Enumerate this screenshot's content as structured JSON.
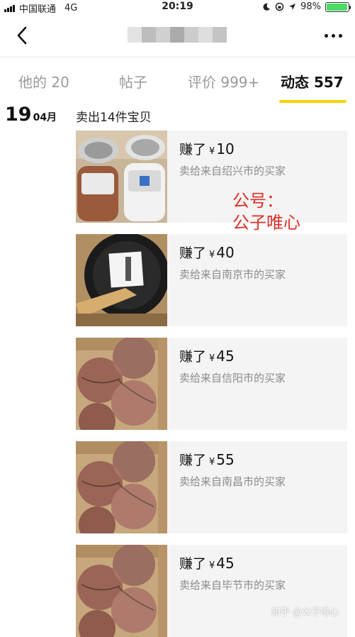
{
  "status_bar": {
    "carrier": "中国联通",
    "network": "4G",
    "time": "20:19",
    "battery": "98%",
    "battery_level": 0.98
  },
  "nav": {
    "title_hidden": true
  },
  "tabs": [
    {
      "label": "他的 20"
    },
    {
      "label": "帖子"
    },
    {
      "label": "评价 999+"
    },
    {
      "label": "动态 557",
      "active": true
    }
  ],
  "feed": {
    "day": "19",
    "month": "04月",
    "summary": "卖出14件宝贝",
    "earn_prefix": "赚了",
    "currency": "¥",
    "items": [
      {
        "amount": "10",
        "buyer": "卖给来自绍兴市的买家",
        "image": "rice-cooker"
      },
      {
        "amount": "40",
        "buyer": "卖给来自南京市的买家",
        "image": "wok-pan"
      },
      {
        "amount": "45",
        "buyer": "卖给来自信阳市的买家",
        "image": "basketballs"
      },
      {
        "amount": "55",
        "buyer": "卖给来自南昌市的买家",
        "image": "basketballs"
      },
      {
        "amount": "45",
        "buyer": "卖给来自毕节市的买家",
        "image": "basketballs"
      }
    ]
  },
  "overlay": {
    "watermark_line1": "公号：",
    "watermark_line2": "公子唯心",
    "zhihu_mark": "知乎 @公子唯心"
  },
  "colors": {
    "accent": "#ffd100",
    "watermark": "#e0302a",
    "battery": "#4cd964"
  }
}
